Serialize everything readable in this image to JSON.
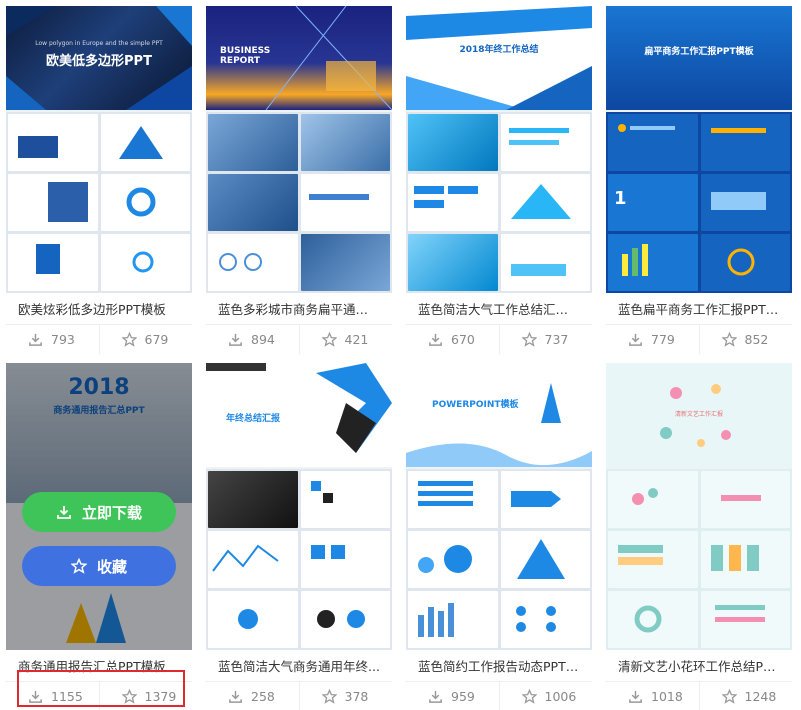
{
  "cards": [
    {
      "title": "欧美炫彩低多边形PPT模板",
      "downloads": "793",
      "favorites": "679",
      "cover_title": "欧美低多边形PPT",
      "cover_sub": "Low polygon in Europe and the simple PPT"
    },
    {
      "title": "蓝色多彩城市商务扁平通用P...",
      "downloads": "894",
      "favorites": "421",
      "cover_title": "BUSINESS REPORT"
    },
    {
      "title": "蓝色简洁大气工作总结汇报P...",
      "downloads": "670",
      "favorites": "737",
      "cover_title": "2018年终工作总结"
    },
    {
      "title": "蓝色扁平商务工作汇报PPT模...",
      "downloads": "779",
      "favorites": "852",
      "cover_title": "扁平商务工作汇报PPT模板"
    },
    {
      "title": "商务通用报告汇总PPT模板",
      "downloads": "1155",
      "favorites": "1379",
      "cover_title": "2018",
      "cover_sub": "商务通用报告汇总PPT"
    },
    {
      "title": "蓝色简洁大气商务通用年终...",
      "downloads": "258",
      "favorites": "378",
      "cover_title": "年终总结汇报"
    },
    {
      "title": "蓝色简约工作报告动态PPT模...",
      "downloads": "959",
      "favorites": "1006",
      "cover_title": "POWERPOINT模板"
    },
    {
      "title": "清新文艺小花环工作总结PPT...",
      "downloads": "1018",
      "favorites": "1248",
      "cover_title": "清新文艺工作汇报"
    }
  ],
  "hover_actions": {
    "download_label": "立即下载",
    "favorite_label": "收藏"
  },
  "colors": {
    "download_btn": "#3fc45a",
    "favorite_btn": "#3f72e0",
    "highlight": "#e0292f"
  }
}
